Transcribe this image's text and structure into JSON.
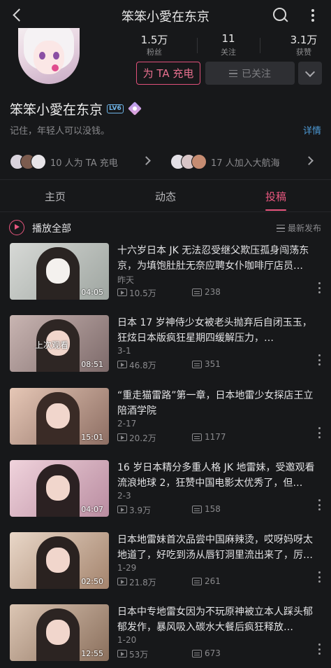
{
  "header": {
    "title": "笨笨小愛在东京"
  },
  "profile": {
    "stats": [
      {
        "value": "1.5万",
        "label": "粉丝"
      },
      {
        "value": "11",
        "label": "关注"
      },
      {
        "value": "3.1万",
        "label": "获赞"
      }
    ],
    "charge_label": "为 TA 充电",
    "follow_label": "已关注",
    "name": "笨笨小愛在东京",
    "level_badge": "LV6",
    "bio": "记住，年轻人可以没钱。",
    "detail_label": "详情"
  },
  "fans": {
    "charge_text": "10 人为 TA 充电",
    "voyage_text": "17 人加入大航海"
  },
  "tabs": [
    "主页",
    "动态",
    "投稿"
  ],
  "active_tab": "投稿",
  "playlist": {
    "play_all": "播放全部",
    "sort": "最新发布"
  },
  "videos": [
    {
      "title": "十六岁日本 JK 无法忍受继父欺压孤身闯荡东京，为填饱肚肚无奈应聘女仆咖啡厅店员…",
      "date": "昨天",
      "duration": "04:05",
      "views": "10.5万",
      "comments": "238",
      "watched": ""
    },
    {
      "title": "日本 17 岁神侍少女被老头抛弃后自闭玉玉，狂炫日本版疯狂星期四缓解压力，…",
      "date": "3-1",
      "duration": "08:51",
      "views": "46.8万",
      "comments": "351",
      "watched": "上次观看"
    },
    {
      "title": "“重走猫雷路”第一章，日本地雷少女探店王立陪酒学院",
      "date": "2-17",
      "duration": "15:01",
      "views": "20.2万",
      "comments": "1177",
      "watched": ""
    },
    {
      "title": "16 岁日本精分多重人格 JK 地雷妹，受邀观看流浪地球 2，狂赞中国电影太优秀了，但…",
      "date": "2-3",
      "duration": "04:07",
      "views": "3.9万",
      "comments": "158",
      "watched": ""
    },
    {
      "title": "日本地雷妹首次品尝中国麻辣烫，哎呀妈呀太地道了，好吃到汤从唇钉洞里流出来了，厉…",
      "date": "1-29",
      "duration": "02:50",
      "views": "21.8万",
      "comments": "261",
      "watched": ""
    },
    {
      "title": "日本中专地雷女因为不玩原神被立本人踩头郁郁发作，暴风吸入碳水大餐后疯狂释放…",
      "date": "1-20",
      "duration": "12:55",
      "views": "53万",
      "comments": "673",
      "watched": ""
    }
  ],
  "colors": {
    "accent": "#e9577f",
    "link": "#4d9ad6",
    "background": "#17181a"
  }
}
